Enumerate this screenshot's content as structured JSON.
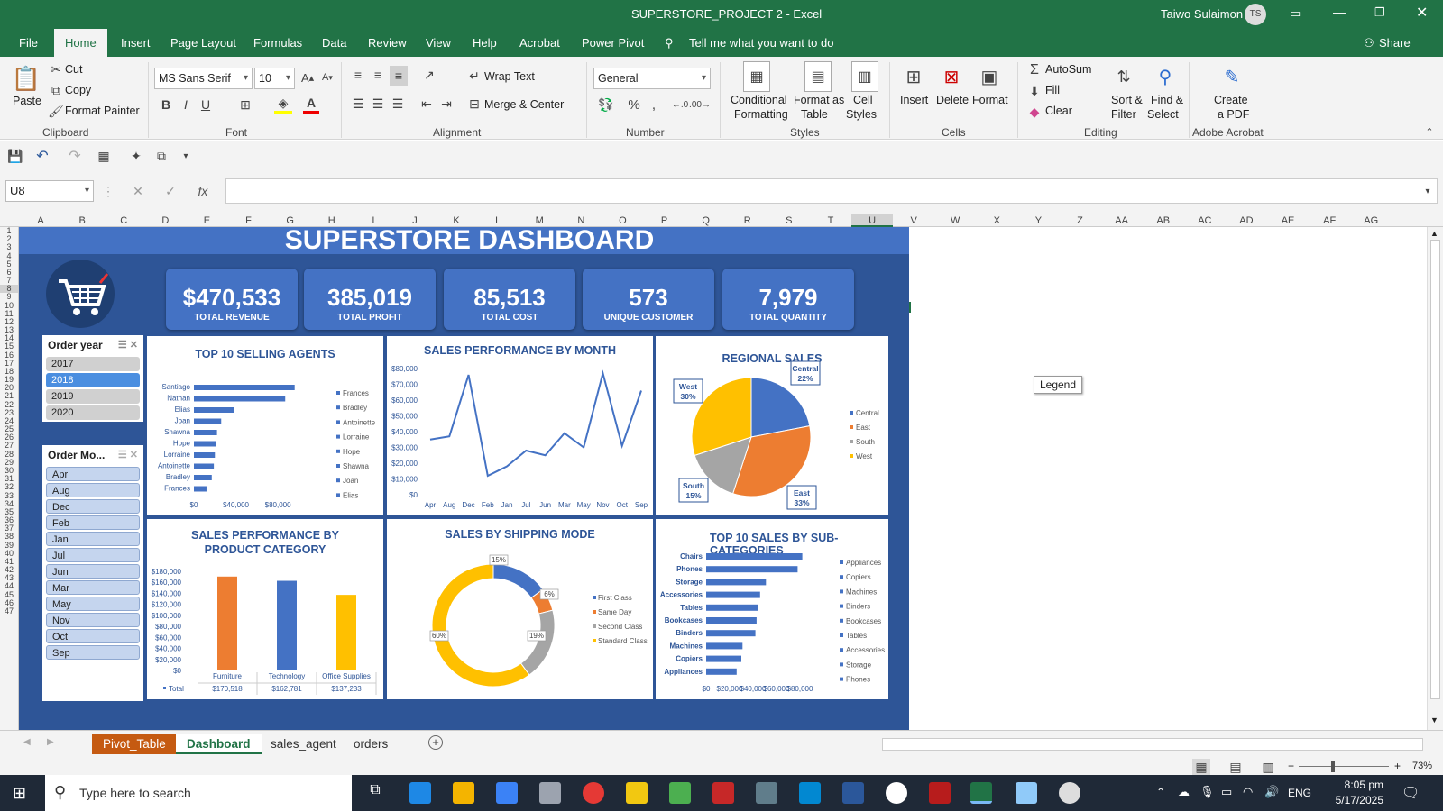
{
  "window": {
    "title": "SUPERSTORE_PROJECT 2  -  Excel",
    "user": "Taiwo Sulaimon",
    "user_initials": "TS"
  },
  "menu": {
    "items": [
      "File",
      "Home",
      "Insert",
      "Page Layout",
      "Formulas",
      "Data",
      "Review",
      "View",
      "Help",
      "Acrobat",
      "Power Pivot"
    ],
    "tell_me": "Tell me what you want to do",
    "share": "Share"
  },
  "ribbon": {
    "clipboard": {
      "paste": "Paste",
      "cut": "Cut",
      "copy": "Copy",
      "format_painter": "Format Painter",
      "label": "Clipboard"
    },
    "font": {
      "family": "MS Sans Serif",
      "size": "10",
      "bold": "B",
      "italic": "I",
      "underline": "U",
      "label": "Font"
    },
    "alignment": {
      "wrap": "Wrap Text",
      "merge": "Merge & Center",
      "label": "Alignment"
    },
    "number": {
      "format": "General",
      "percent": "%",
      "comma": ",",
      "label": "Number"
    },
    "styles": {
      "cond1": "Conditional",
      "cond2": "Formatting",
      "fmt1": "Format as",
      "fmt2": "Table",
      "cell1": "Cell",
      "cell2": "Styles",
      "label": "Styles"
    },
    "cells": {
      "insert": "Insert",
      "delete": "Delete",
      "format": "Format",
      "label": "Cells"
    },
    "editing": {
      "autosum": "AutoSum",
      "fill": "Fill",
      "clear": "Clear",
      "sort1": "Sort &",
      "sort2": "Filter",
      "find1": "Find &",
      "find2": "Select",
      "label": "Editing"
    },
    "acrobat": {
      "create1": "Create",
      "create2": "a PDF",
      "label": "Adobe Acrobat"
    }
  },
  "formula_bar": {
    "name_box": "U8",
    "fx": "fx",
    "value": ""
  },
  "columns": [
    "A",
    "B",
    "C",
    "D",
    "E",
    "F",
    "G",
    "H",
    "I",
    "J",
    "K",
    "L",
    "M",
    "N",
    "O",
    "P",
    "Q",
    "R",
    "S",
    "T",
    "U",
    "V",
    "W",
    "X",
    "Y",
    "Z",
    "AA",
    "AB",
    "AC",
    "AD",
    "AE",
    "AF",
    "AG"
  ],
  "rows": [
    "1",
    "2",
    "3",
    "4",
    "5",
    "6",
    "7",
    "8",
    "9",
    "10",
    "11",
    "12",
    "13",
    "14",
    "15",
    "16",
    "17",
    "18",
    "19",
    "20",
    "21",
    "22",
    "23",
    "24",
    "25",
    "26",
    "27",
    "28",
    "29",
    "30",
    "31",
    "32",
    "33",
    "34",
    "35",
    "36",
    "37",
    "38",
    "39",
    "40",
    "41",
    "42",
    "43",
    "44",
    "45",
    "46",
    "47"
  ],
  "dashboard": {
    "title": "SUPERSTORE DASHBOARD",
    "kpis": [
      {
        "value": "$470,533",
        "label": "TOTAL REVENUE"
      },
      {
        "value": "385,019",
        "label": "TOTAL PROFIT"
      },
      {
        "value": "85,513",
        "label": "TOTAL COST"
      },
      {
        "value": "573",
        "label": "UNIQUE CUSTOMER"
      },
      {
        "value": "7,979",
        "label": "TOTAL QUANTITY"
      }
    ],
    "slicer_year": {
      "title": "Order year",
      "items": [
        "2017",
        "2018",
        "2019",
        "2020"
      ],
      "selected": "2018"
    },
    "slicer_month": {
      "title": "Order Mo...",
      "items": [
        "Apr",
        "Aug",
        "Dec",
        "Feb",
        "Jan",
        "Jul",
        "Jun",
        "Mar",
        "May",
        "Nov",
        "Oct",
        "Sep"
      ]
    },
    "legend_tooltip": "Legend"
  },
  "chart_data": [
    {
      "type": "bar",
      "title": "TOP 10 SELLING AGENTS",
      "orientation": "horizontal",
      "categories": [
        "Santiago",
        "Nathan",
        "Elias",
        "Joan",
        "Shawna",
        "Hope",
        "Lorraine",
        "Antoinette",
        "Bradley",
        "Frances"
      ],
      "values": [
        96000,
        87000,
        38000,
        26000,
        22000,
        21000,
        20000,
        19000,
        17000,
        12000
      ],
      "xticks": [
        "$0",
        "$40,000",
        "$80,000"
      ],
      "xlim": [
        0,
        110000
      ],
      "legend": [
        "Frances",
        "Bradley",
        "Antoinette",
        "Lorraine",
        "Hope",
        "Shawna",
        "Joan",
        "Elias"
      ],
      "color": "#4472c4"
    },
    {
      "type": "line",
      "title": "SALES PERFORMANCE BY MONTH",
      "categories": [
        "Apr",
        "Aug",
        "Dec",
        "Feb",
        "Jan",
        "Jul",
        "Jun",
        "Mar",
        "May",
        "Nov",
        "Oct",
        "Sep"
      ],
      "values": [
        35000,
        37000,
        76000,
        12000,
        18000,
        28000,
        25000,
        39000,
        30000,
        77000,
        31000,
        66000
      ],
      "yticks": [
        "$0",
        "$10,000",
        "$20,000",
        "$30,000",
        "$40,000",
        "$50,000",
        "$60,000",
        "$70,000",
        "$80,000"
      ],
      "ylim": [
        0,
        80000
      ],
      "color": "#4472c4"
    },
    {
      "type": "pie",
      "title": "REGIONAL SALES",
      "categories": [
        "Central",
        "East",
        "South",
        "West"
      ],
      "values": [
        22,
        33,
        15,
        30
      ],
      "labels": [
        "Central\n22%",
        "East\n33%",
        "South\n15%",
        "West\n30%"
      ],
      "colors": [
        "#4472c4",
        "#ed7d31",
        "#a5a5a5",
        "#ffc000"
      ]
    },
    {
      "type": "bar",
      "title": "SALES PERFORMANCE BY PRODUCT CATEGORY",
      "categories": [
        "Furniture",
        "Technology",
        "Office Supplies"
      ],
      "values": [
        170518,
        162781,
        137233
      ],
      "table_row_label": "Total",
      "table_values": [
        "$170,518",
        "$162,781",
        "$137,233"
      ],
      "yticks": [
        "$0",
        "$20,000",
        "$40,000",
        "$60,000",
        "$80,000",
        "$100,000",
        "$120,000",
        "$140,000",
        "$160,000",
        "$180,000"
      ],
      "ylim": [
        0,
        180000
      ],
      "colors": [
        "#ed7d31",
        "#4472c4",
        "#ffc000"
      ]
    },
    {
      "type": "pie",
      "variant": "donut",
      "title": "SALES BY SHIPPING MODE",
      "categories": [
        "First Class",
        "Same Day",
        "Second Class",
        "Standard Class"
      ],
      "values": [
        15,
        6,
        19,
        60
      ],
      "labels": [
        "15%",
        "6%",
        "19%",
        "60%"
      ],
      "colors": [
        "#4472c4",
        "#ed7d31",
        "#a5a5a5",
        "#ffc000"
      ]
    },
    {
      "type": "bar",
      "title": "TOP 10 SALES BY SUB-CATEGORIES",
      "orientation": "horizontal",
      "categories": [
        "Chairs",
        "Phones",
        "Storage",
        "Accessories",
        "Tables",
        "Bookcases",
        "Binders",
        "Machines",
        "Copiers",
        "Appliances"
      ],
      "values": [
        82000,
        78000,
        51000,
        46000,
        44000,
        43000,
        42000,
        31000,
        30000,
        26000
      ],
      "xticks": [
        "$0",
        "$20,000",
        "$40,000",
        "$60,000",
        "$80,000"
      ],
      "xlim": [
        0,
        100000
      ],
      "legend": [
        "Appliances",
        "Copiers",
        "Machines",
        "Binders",
        "Bookcases",
        "Tables",
        "Accessories",
        "Storage",
        "Phones"
      ],
      "color": "#4472c4"
    }
  ],
  "sheets": {
    "tabs": [
      "Pivot_Table",
      "Dashboard",
      "sales_agent",
      "orders"
    ],
    "active": "Dashboard"
  },
  "status": {
    "zoom": "73%"
  },
  "taskbar": {
    "search": "Type here to search",
    "lang": "ENG",
    "time": "8:05 pm",
    "date": "5/17/2025"
  }
}
